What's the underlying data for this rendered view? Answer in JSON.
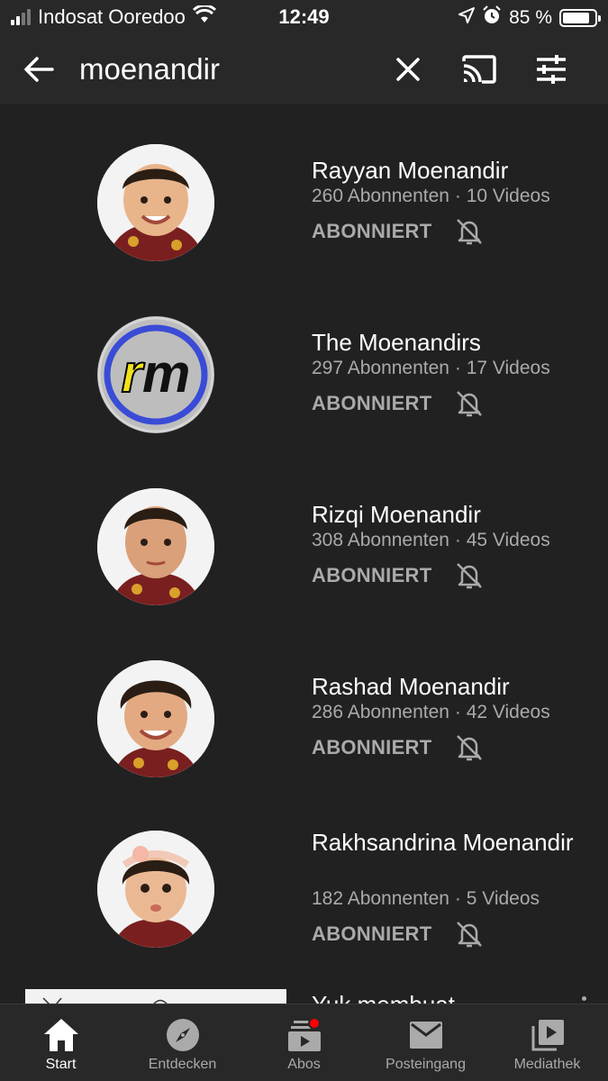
{
  "status_bar": {
    "carrier": "Indosat Ooredoo",
    "time": "12:49",
    "battery": "85 %",
    "battery_level": 0.85
  },
  "search": {
    "query": "moenandir"
  },
  "channels": [
    {
      "name": "Rayyan Moenandir",
      "subscribers": "260 Abonnenten",
      "videos": "10 Videos",
      "status": "ABONNIERT",
      "avatar": "child-photo"
    },
    {
      "name": "The Moenandirs",
      "subscribers": "297 Abonnenten",
      "videos": "17 Videos",
      "status": "ABONNIERT",
      "avatar": "rm-logo"
    },
    {
      "name": "Rizqi Moenandir",
      "subscribers": "308 Abonnenten",
      "videos": "45 Videos",
      "status": "ABONNIERT",
      "avatar": "child-photo"
    },
    {
      "name": "Rashad Moenandir",
      "subscribers": "286 Abonnenten",
      "videos": "42 Videos",
      "status": "ABONNIERT",
      "avatar": "child-photo"
    },
    {
      "name": "Rakhsandrina Moenandir",
      "subscribers": "182 Abonnenten",
      "videos": "5 Videos",
      "status": "ABONNIERT",
      "avatar": "child-photo"
    }
  ],
  "partial_video": {
    "title": "Yuk membuat"
  },
  "separator": "·",
  "logo_text": "rm",
  "bottom_nav": [
    {
      "label": "Start",
      "icon": "home-icon",
      "active": true
    },
    {
      "label": "Entdecken",
      "icon": "compass-icon",
      "active": false
    },
    {
      "label": "Abos",
      "icon": "subscriptions-icon",
      "active": false
    },
    {
      "label": "Posteingang",
      "icon": "mail-icon",
      "active": false
    },
    {
      "label": "Mediathek",
      "icon": "library-icon",
      "active": false
    }
  ],
  "colors": {
    "background": "#212121",
    "header": "#282828",
    "secondary_text": "#aaaaaa",
    "notification_dot": "#ff0000"
  }
}
